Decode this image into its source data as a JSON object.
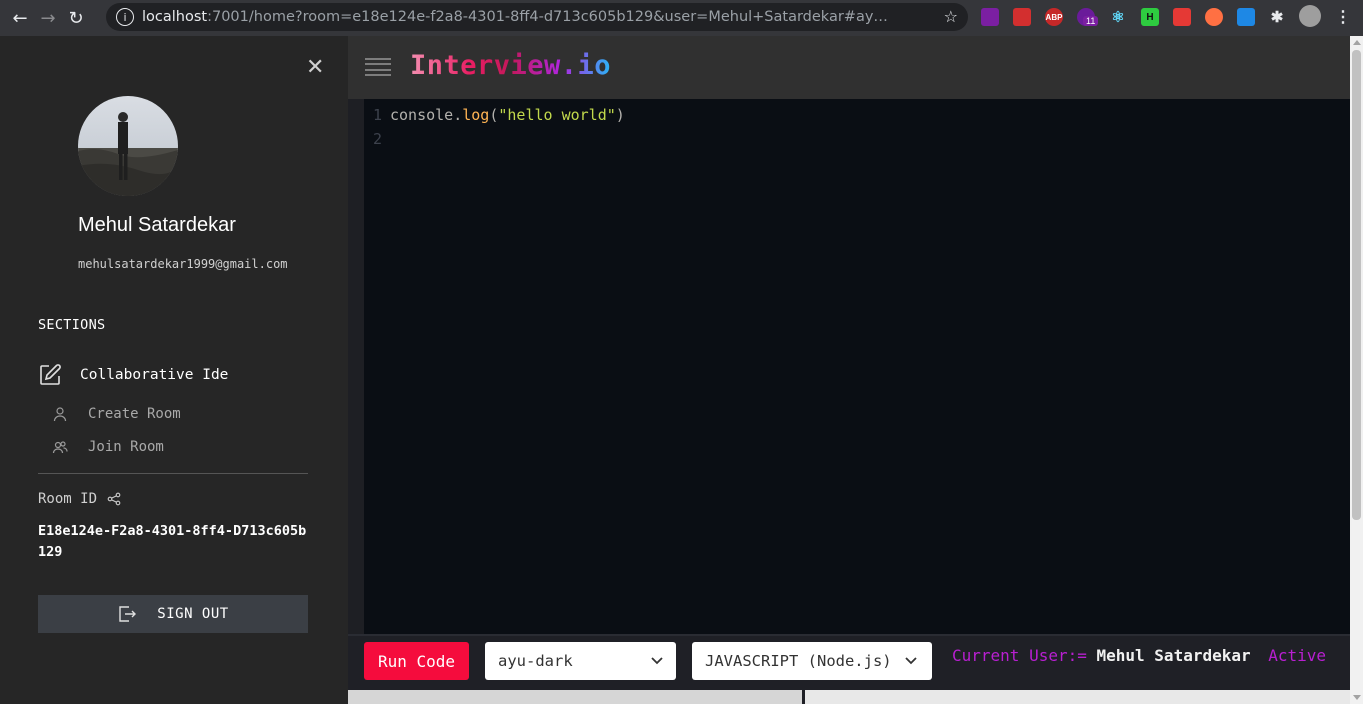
{
  "browser": {
    "url_host": "localhost",
    "url_rest": ":7001/home?room=e18e124e-f2a8-4301-8ff4-d713c605b129&user=Mehul+Satardekar#ay…",
    "extension_badge": "11",
    "ext_labels": {
      "abp": "ABP",
      "h": "H"
    }
  },
  "sidebar": {
    "profile_name": "Mehul Satardekar",
    "profile_email": "mehulsatardekar1999@gmail.com",
    "sections_title": "SECTIONS",
    "main_item": "Collaborative Ide",
    "sub_items": [
      {
        "label": "Create Room",
        "icon": "user-icon"
      },
      {
        "label": "Join Room",
        "icon": "users-icon"
      }
    ],
    "room_id_label": "Room ID",
    "room_id_value": "E18e124e-F2a8-4301-8ff4-D713c605b129",
    "signout_label": "SIGN OUT"
  },
  "header": {
    "brand": "Interview.io"
  },
  "editor": {
    "lines": [
      {
        "number": "1",
        "obj": "console",
        "dot": ".",
        "fn": "log",
        "open": "(",
        "str": "\"hello world\"",
        "close": ")"
      },
      {
        "number": "2"
      }
    ]
  },
  "toolbar": {
    "run_label": "Run Code",
    "theme_value": "ayu-dark",
    "language_value": "JAVASCRIPT (Node.js)",
    "current_user_key": "Current User:=",
    "current_user_value": "Mehul Satardekar",
    "active_label": "Active"
  },
  "colors": {
    "run_button": "#f50c3d",
    "status_key": "#b81fd1",
    "editor_bg": "#0a0e14"
  }
}
